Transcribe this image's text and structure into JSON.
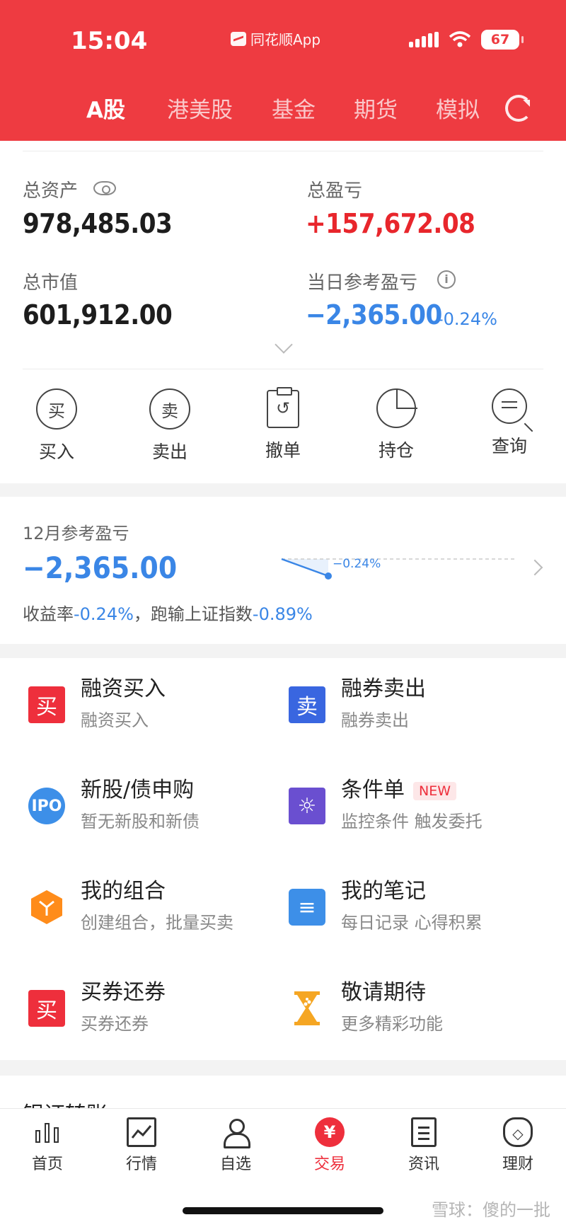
{
  "status_bar": {
    "time": "15:04",
    "app_name": "同花顺App",
    "battery": "67"
  },
  "top_tabs": [
    {
      "label": "A股",
      "active": true
    },
    {
      "label": "港美股",
      "active": false
    },
    {
      "label": "基金",
      "active": false
    },
    {
      "label": "期货",
      "active": false
    },
    {
      "label": "模拟",
      "active": false
    }
  ],
  "assets": {
    "total_assets_label": "总资产",
    "total_assets": "978,485.03",
    "total_pnl_label": "总盈亏",
    "total_pnl": "+157,672.08",
    "market_value_label": "总市值",
    "market_value": "601,912.00",
    "daily_pnl_label": "当日参考盈亏",
    "daily_pnl": "−2,365.00",
    "daily_pnl_pct": "-0.24%"
  },
  "actions": [
    {
      "label": "买入",
      "glyph": "买"
    },
    {
      "label": "卖出",
      "glyph": "卖"
    },
    {
      "label": "撤单",
      "glyph": "↺"
    },
    {
      "label": "持仓"
    },
    {
      "label": "查询"
    }
  ],
  "month_pnl": {
    "title": "12月参考盈亏",
    "value": "−2,365.00",
    "spark_label": "−0.24%",
    "yield_prefix": "收益率",
    "yield_value": "-0.24%",
    "sep": "，跑输上证指数",
    "index_value": "-0.89%"
  },
  "features": [
    {
      "title": "融资买入",
      "sub": "融资买入",
      "icon": "买",
      "icon_name": "margin-buy-icon"
    },
    {
      "title": "融券卖出",
      "sub": "融券卖出",
      "icon": "卖",
      "icon_name": "short-sell-icon"
    },
    {
      "title": "新股/债申购",
      "sub": "暂无新股和新债",
      "icon": "IPO",
      "icon_name": "ipo-icon"
    },
    {
      "title": "条件单",
      "sub": "监控条件 触发委托",
      "icon": "☼",
      "icon_name": "condition-order-icon",
      "badge": "NEW"
    },
    {
      "title": "我的组合",
      "sub": "创建组合，批量买卖",
      "icon": "Y",
      "icon_name": "portfolio-icon"
    },
    {
      "title": "我的笔记",
      "sub": "每日记录 心得积累",
      "icon": "≡",
      "icon_name": "notes-icon"
    },
    {
      "title": "买券还券",
      "sub": "买券还券",
      "icon": "买",
      "icon_name": "buy-return-icon"
    },
    {
      "title": "敬请期待",
      "sub": "更多精彩功能",
      "icon": "⧗",
      "icon_name": "hourglass-icon"
    }
  ],
  "bank_transfer_title": "银证转账",
  "bottom_nav": [
    {
      "label": "首页",
      "active": false
    },
    {
      "label": "行情",
      "active": false
    },
    {
      "label": "自选",
      "active": false
    },
    {
      "label": "交易",
      "active": true
    },
    {
      "label": "资讯",
      "active": false
    },
    {
      "label": "理财",
      "active": false
    }
  ],
  "watermark": "雪球：傻的一批",
  "colors": {
    "brand_red": "#ee3b41",
    "loss_blue": "#3a86e6",
    "gain_red": "#e8262c"
  }
}
